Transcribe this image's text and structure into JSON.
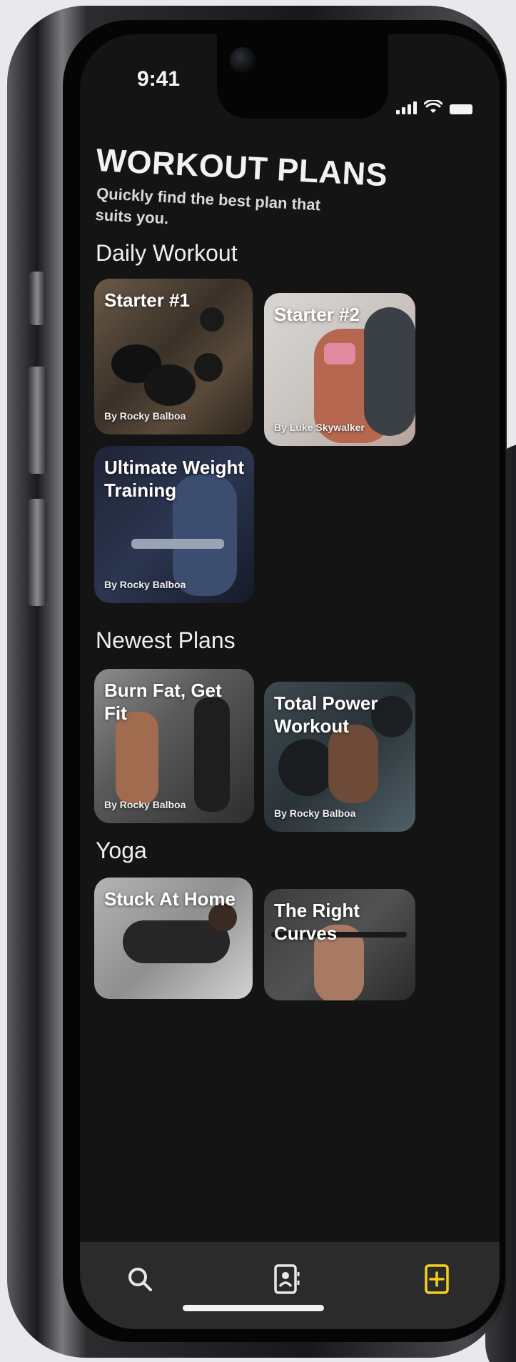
{
  "status": {
    "time": "9:41"
  },
  "header": {
    "title": "WORKOUT PLANS",
    "subtitle": "Quickly find the best plan that suits you."
  },
  "sections": [
    {
      "label": "Daily Workout",
      "cards": [
        {
          "title": "Starter #1",
          "author": "By Rocky Balboa"
        },
        {
          "title": "Starter #2",
          "author": "By Luke Skywalker"
        },
        {
          "title": "Ultimate Weight Training",
          "author": "By Rocky Balboa"
        }
      ]
    },
    {
      "label": "Newest Plans",
      "cards": [
        {
          "title": "Burn Fat, Get Fit",
          "author": "By Rocky Balboa"
        },
        {
          "title": "Total Power Workout",
          "author": "By Rocky Balboa"
        }
      ]
    },
    {
      "label": "Yoga",
      "cards": [
        {
          "title": "Stuck At Home",
          "author": ""
        },
        {
          "title": "The Right Curves",
          "author": ""
        }
      ]
    }
  ],
  "tabbar": {
    "items": [
      {
        "icon": "search-icon",
        "active": false
      },
      {
        "icon": "contacts-book-icon",
        "active": false
      },
      {
        "icon": "plans-icon",
        "active": true
      }
    ],
    "accent": "#f5d21a",
    "inactive": "#e8e8e8"
  }
}
